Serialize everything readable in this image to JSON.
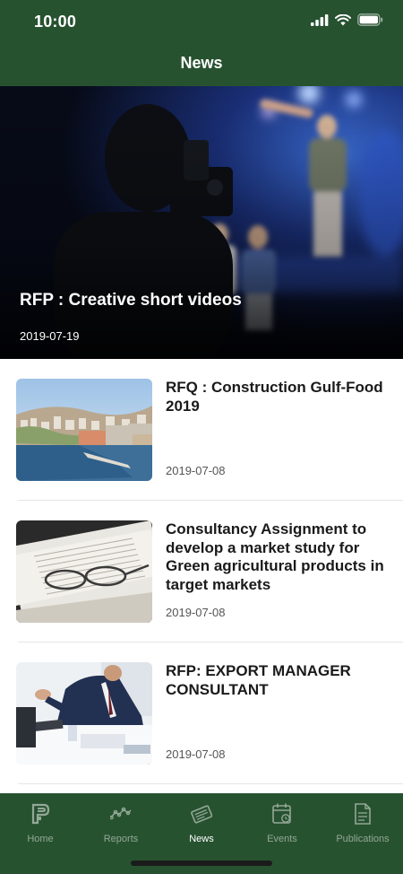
{
  "status_bar": {
    "time": "10:00"
  },
  "header": {
    "title": "News"
  },
  "hero": {
    "title": "RFP : Creative short videos",
    "date": "2019-07-19"
  },
  "news": [
    {
      "title": "RFQ : Construction Gulf-Food 2019",
      "date": "2019-07-08",
      "thumb": "coastal-city-photo"
    },
    {
      "title": "Consultancy Assignment to develop a market study for Green agricultural products in target markets",
      "date": "2019-07-08",
      "thumb": "glasses-on-document-photo"
    },
    {
      "title": "RFP: EXPORT MANAGER CONSULTANT",
      "date": "2019-07-08",
      "thumb": "businessman-at-desk-photo"
    }
  ],
  "tabs": [
    {
      "label": "Home",
      "icon": "home-logo-icon",
      "active": false
    },
    {
      "label": "Reports",
      "icon": "chart-line-icon",
      "active": false
    },
    {
      "label": "News",
      "icon": "newspaper-icon",
      "active": true
    },
    {
      "label": "Events",
      "icon": "calendar-icon",
      "active": false
    },
    {
      "label": "Publications",
      "icon": "document-icon",
      "active": false
    }
  ],
  "colors": {
    "primary": "#275230",
    "tab_inactive": "#93a896",
    "tab_active": "#ffffff"
  }
}
